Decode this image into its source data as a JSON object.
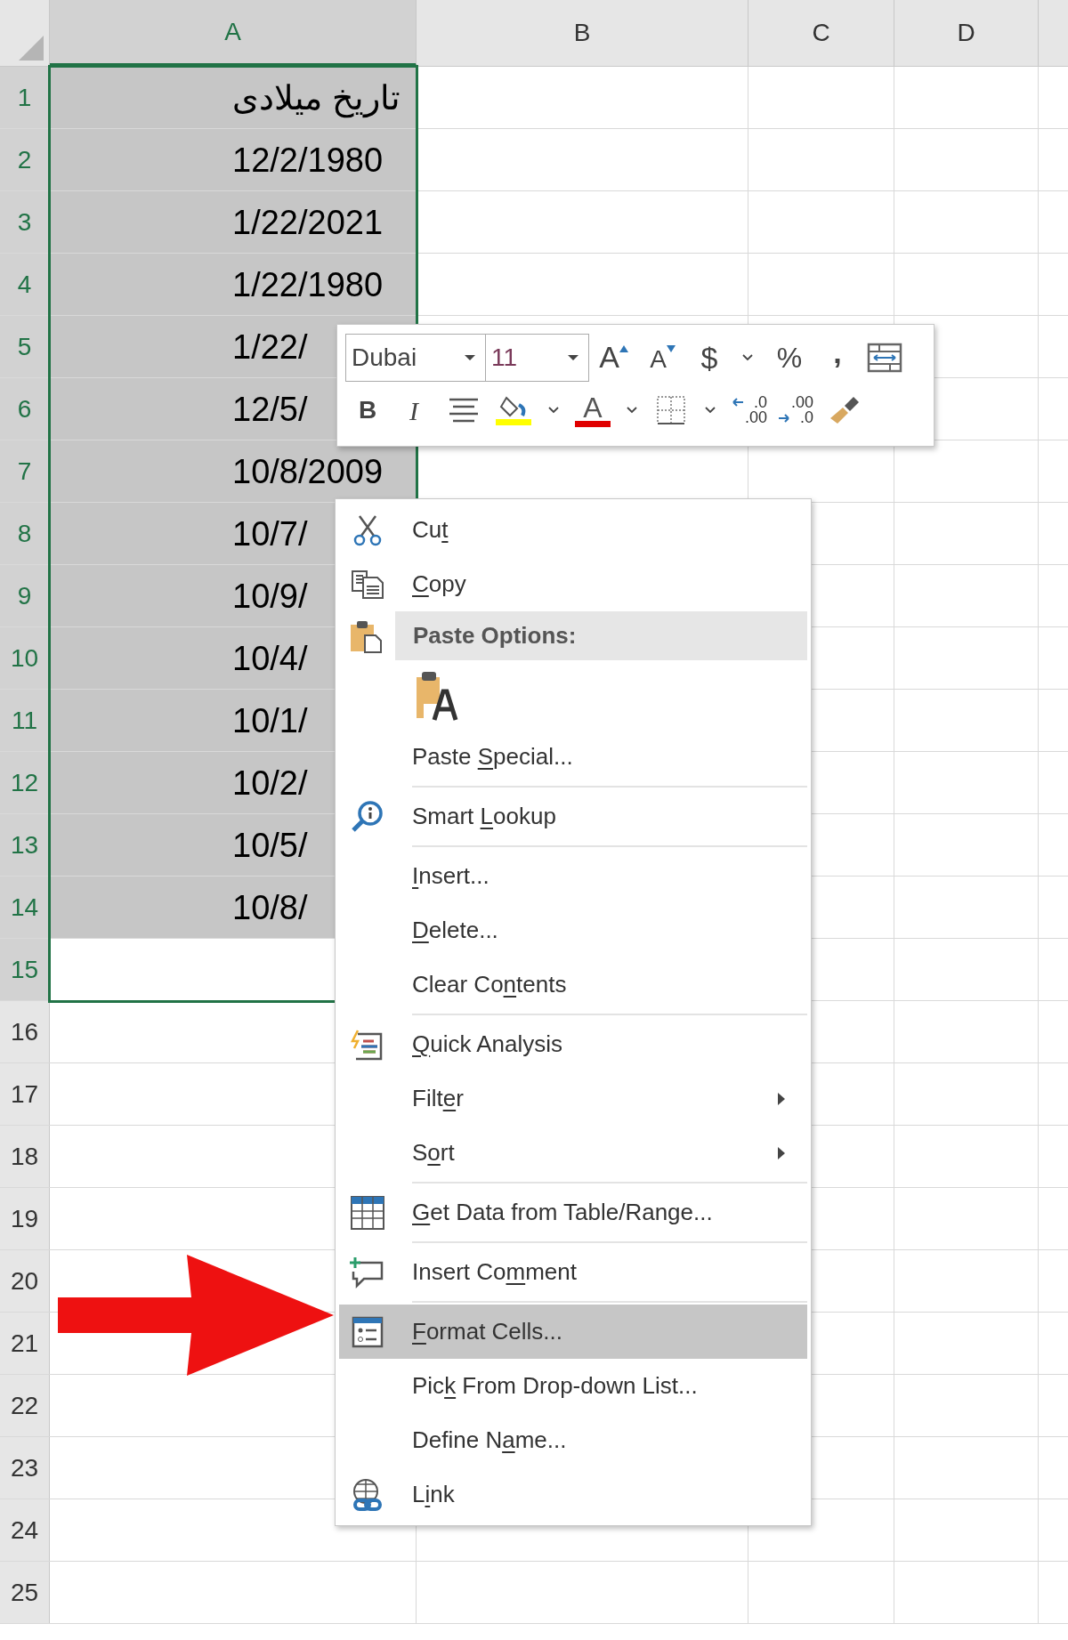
{
  "columns": [
    {
      "label": "A",
      "selected": true
    },
    {
      "label": "B",
      "selected": false
    },
    {
      "label": "C",
      "selected": false
    },
    {
      "label": "D",
      "selected": false
    }
  ],
  "rows": [
    {
      "number": "1",
      "selected": true,
      "cell_a": "تاریخ میلادی"
    },
    {
      "number": "2",
      "selected": true,
      "cell_a": "12/2/1980"
    },
    {
      "number": "3",
      "selected": true,
      "cell_a": "1/22/2021"
    },
    {
      "number": "4",
      "selected": true,
      "cell_a": "1/22/1980"
    },
    {
      "number": "5",
      "selected": true,
      "cell_a": "1/22/"
    },
    {
      "number": "6",
      "selected": true,
      "cell_a": "12/5/"
    },
    {
      "number": "7",
      "selected": true,
      "cell_a": "10/8/2009"
    },
    {
      "number": "8",
      "selected": true,
      "cell_a": "10/7/"
    },
    {
      "number": "9",
      "selected": true,
      "cell_a": "10/9/"
    },
    {
      "number": "10",
      "selected": true,
      "cell_a": "10/4/"
    },
    {
      "number": "11",
      "selected": true,
      "cell_a": "10/1/"
    },
    {
      "number": "12",
      "selected": true,
      "cell_a": "10/2/"
    },
    {
      "number": "13",
      "selected": true,
      "cell_a": "10/5/"
    },
    {
      "number": "14",
      "selected": true,
      "cell_a": "10/8/"
    },
    {
      "number": "15",
      "selected": true
    },
    {
      "number": "16",
      "selected": false
    },
    {
      "number": "17",
      "selected": false
    },
    {
      "number": "18",
      "selected": false
    },
    {
      "number": "19",
      "selected": false
    },
    {
      "number": "20",
      "selected": false
    },
    {
      "number": "21",
      "selected": false
    },
    {
      "number": "22",
      "selected": false
    },
    {
      "number": "23",
      "selected": false
    },
    {
      "number": "24",
      "selected": false
    },
    {
      "number": "25",
      "selected": false
    }
  ],
  "mini_toolbar": {
    "font_field": {
      "value": "Dubai"
    },
    "size_field": {
      "value": "11"
    },
    "row_1": [
      {
        "kind": "grow_font",
        "glyph": "A"
      },
      {
        "kind": "shrink_font",
        "glyph": "A"
      },
      {
        "kind": "currency",
        "glyph": "$"
      },
      {
        "kind": "dropdown"
      },
      {
        "kind": "percent",
        "glyph": "%"
      },
      {
        "kind": "comma",
        "glyph": ","
      },
      {
        "kind": "wrap"
      }
    ],
    "row_2": [
      {
        "kind": "bold",
        "glyph": "B"
      },
      {
        "kind": "italic",
        "glyph": "I"
      },
      {
        "kind": "align"
      },
      {
        "kind": "fill_color",
        "color": "#ffff00"
      },
      {
        "kind": "dropdown"
      },
      {
        "kind": "font_color",
        "glyph": "A",
        "color": "#e00000"
      },
      {
        "kind": "dropdown"
      },
      {
        "kind": "borders"
      },
      {
        "kind": "dropdown"
      },
      {
        "kind": "increase_decimal",
        "glyph_top": ".0",
        "glyph_bottom": ".00"
      },
      {
        "kind": "decrease_decimal",
        "glyph_top": ".00",
        "glyph_bottom": ".0"
      },
      {
        "kind": "format_painter"
      }
    ]
  },
  "context_menu": {
    "items": [
      {
        "kind": "item",
        "label": {
          "before": "Cu",
          "key": "t"
        },
        "selected": false
      },
      {
        "kind": "item",
        "label": {
          "key": "C",
          "after": "opy"
        },
        "selected": false
      },
      {
        "kind": "header",
        "text": "Paste Options:"
      },
      {
        "kind": "paste_buttons"
      },
      {
        "kind": "item",
        "label": {
          "before": "Paste ",
          "key": "S",
          "after": "pecial..."
        },
        "selected": false
      },
      {
        "kind": "separator"
      },
      {
        "kind": "item",
        "label": {
          "before": "Smart ",
          "key": "L",
          "after": "ookup"
        },
        "selected": false
      },
      {
        "kind": "separator"
      },
      {
        "kind": "item",
        "label": {
          "key": "I",
          "after": "nsert..."
        },
        "selected": false
      },
      {
        "kind": "item",
        "label": {
          "key": "D",
          "after": "elete..."
        },
        "selected": false
      },
      {
        "kind": "item",
        "label": {
          "before": "Clear Co",
          "key": "n",
          "after": "tents"
        },
        "selected": false
      },
      {
        "kind": "separator"
      },
      {
        "kind": "item",
        "label": {
          "key": "Q",
          "after": "uick Analysis"
        },
        "selected": false
      },
      {
        "kind": "item",
        "label": {
          "before": "Filt",
          "key": "e",
          "after": "r"
        },
        "submenu": true,
        "selected": false
      },
      {
        "kind": "item",
        "label": {
          "before": "S",
          "key": "o",
          "after": "rt"
        },
        "submenu": true,
        "selected": false
      },
      {
        "kind": "separator"
      },
      {
        "kind": "item",
        "label": {
          "key": "G",
          "after": "et Data from Table/Range..."
        },
        "selected": false
      },
      {
        "kind": "separator"
      },
      {
        "kind": "item",
        "label": {
          "before": "Insert Co",
          "key": "m",
          "after": "ment"
        },
        "selected": false
      },
      {
        "kind": "separator"
      },
      {
        "kind": "item",
        "label": {
          "key": "F",
          "after": "ormat Cells..."
        },
        "selected": true
      },
      {
        "kind": "item",
        "label": {
          "before": "Pic",
          "key": "k",
          "after": " From Drop-down List..."
        },
        "selected": false
      },
      {
        "kind": "item",
        "label": {
          "before": "Define N",
          "key": "a",
          "after": "me..."
        },
        "selected": false
      },
      {
        "kind": "item",
        "label": {
          "before": "L",
          "key": "i",
          "after": "nk"
        },
        "selected": false
      }
    ]
  }
}
